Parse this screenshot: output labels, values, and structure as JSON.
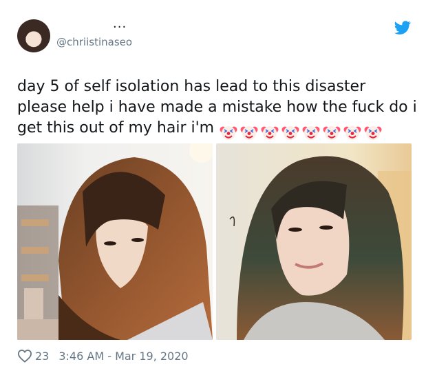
{
  "tweet": {
    "author_name_placeholder": "...",
    "handle": "@chriistinaseo",
    "text_lines": [
      "day 5 of self isolation has lead to this disaster",
      "please help i have made a mistake how the fuck do i",
      "get this out of my hair i'm"
    ],
    "emoji": "clown-face-emoji",
    "emoji_count": 8,
    "likes": "23",
    "timestamp": "3:46 AM - Mar 19, 2020",
    "brand_color": "#1da1f2",
    "text_color": "#14171a",
    "muted_color": "#657786"
  }
}
